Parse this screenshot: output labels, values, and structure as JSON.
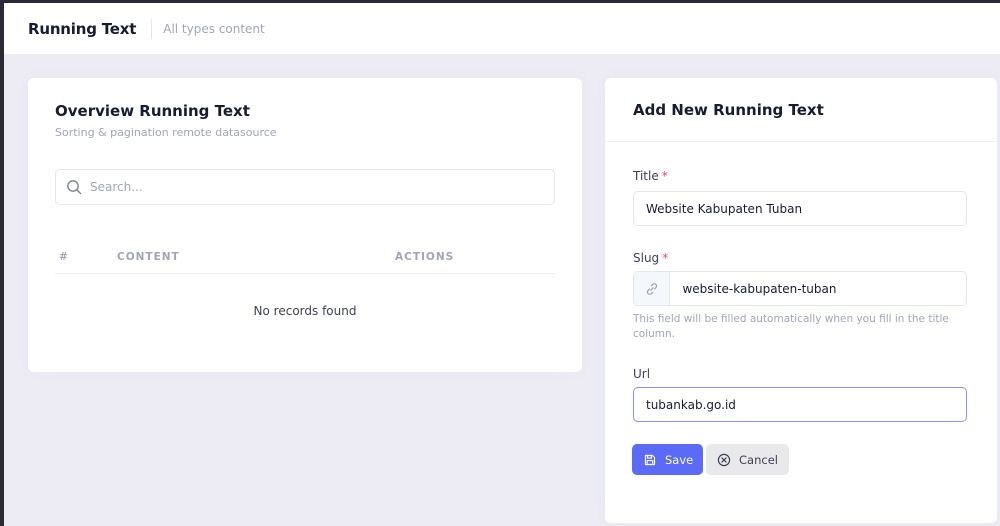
{
  "header": {
    "title": "Running Text",
    "subtitle": "All types content"
  },
  "overview": {
    "title": "Overview Running Text",
    "subtitle": "Sorting & pagination remote datasource",
    "search_placeholder": "Search...",
    "columns": [
      "#",
      "CONTENT",
      "ACTIONS"
    ],
    "empty_text": "No records found"
  },
  "form": {
    "title": "Add New Running Text",
    "title_label": "Title",
    "title_value": "Website Kabupaten Tuban",
    "slug_label": "Slug",
    "slug_value": "website-kabupaten-tuban",
    "slug_help": "This field will be filled automatically when you fill in the title column.",
    "url_label": "Url",
    "url_value": "tubankab.go.id",
    "required_mark": "*",
    "save_label": "Save",
    "cancel_label": "Cancel"
  },
  "icons": {
    "search": "search-icon",
    "link": "link-icon",
    "save": "floppy-disk-icon",
    "cancel": "circle-x-icon"
  },
  "colors": {
    "primary": "#5c6bf7",
    "required": "#f1416c",
    "muted": "#a1a5b7",
    "background": "#edecf4"
  }
}
